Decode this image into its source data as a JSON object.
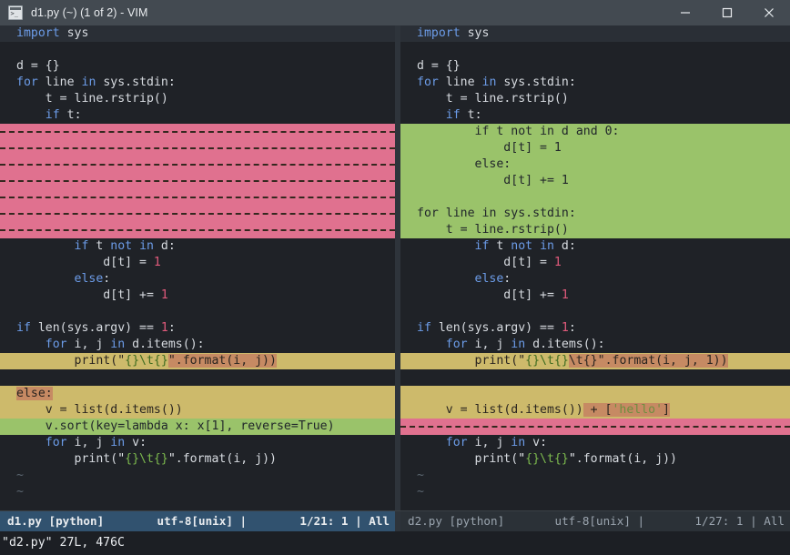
{
  "window": {
    "title": "d1.py (~) (1 of 2) - VIM",
    "icon": "terminal-icon",
    "controls": {
      "minimize": "minimize-icon",
      "maximize": "maximize-icon",
      "close": "close-icon"
    }
  },
  "colors": {
    "titlebar": "#434a51",
    "editor_bg": "#1f2227",
    "cursorline": "#2a2f36",
    "diff_add": "#9ac36a",
    "diff_delete": "#e0718f",
    "diff_change": "#cdba6b",
    "diff_text": "#c68a63",
    "statusline_active": "#31526f",
    "statusline_inactive": "#2b3137",
    "keyword": "#6c9ce8",
    "number": "#e05a7b",
    "string_format": "#7dba4e"
  },
  "panes": {
    "left": {
      "file": "d1.py",
      "lines": [
        {
          "n": 1,
          "kind": "cursorline",
          "text": "import sys"
        },
        {
          "n": 2,
          "kind": "normal",
          "text": ""
        },
        {
          "n": 3,
          "kind": "normal",
          "text": "d = {}"
        },
        {
          "n": 4,
          "kind": "normal",
          "text": "for line in sys.stdin:"
        },
        {
          "n": 5,
          "kind": "normal",
          "text": "    t = line.rstrip()"
        },
        {
          "n": 6,
          "kind": "normal",
          "text": "    if t:"
        },
        {
          "n": 7,
          "kind": "filler",
          "text": ""
        },
        {
          "n": 8,
          "kind": "filler",
          "text": ""
        },
        {
          "n": 9,
          "kind": "filler",
          "text": ""
        },
        {
          "n": 10,
          "kind": "filler",
          "text": ""
        },
        {
          "n": 11,
          "kind": "filler",
          "text": ""
        },
        {
          "n": 12,
          "kind": "filler",
          "text": ""
        },
        {
          "n": 13,
          "kind": "filler",
          "text": ""
        },
        {
          "n": 14,
          "kind": "normal",
          "text": "        if t not in d:"
        },
        {
          "n": 15,
          "kind": "normal",
          "text": "            d[t] = 1"
        },
        {
          "n": 16,
          "kind": "normal",
          "text": "        else:"
        },
        {
          "n": 17,
          "kind": "normal",
          "text": "            d[t] += 1"
        },
        {
          "n": 18,
          "kind": "normal",
          "text": ""
        },
        {
          "n": 19,
          "kind": "normal",
          "text": "if len(sys.argv) == 1:"
        },
        {
          "n": 20,
          "kind": "normal",
          "text": "    for i, j in d.items():"
        },
        {
          "n": 21,
          "kind": "change",
          "text": "        print(\"{}\\t{}\".format(i, j))",
          "plain": "        print(\"{}\\t{}",
          "changed": "\".format(i, j))"
        },
        {
          "n": 22,
          "kind": "normal",
          "text": ""
        },
        {
          "n": 23,
          "kind": "change",
          "text": "else:",
          "plain": "",
          "changed": "else:"
        },
        {
          "n": 24,
          "kind": "change",
          "text": "    v = list(d.items())",
          "plain": "    v = list(d.items())",
          "changed": ""
        },
        {
          "n": 25,
          "kind": "add",
          "text": "    v.sort(key=lambda x: x[1], reverse=True)"
        },
        {
          "n": 26,
          "kind": "normal",
          "text": "    for i, j in v:"
        },
        {
          "n": 27,
          "kind": "normal",
          "text": "        print(\"{}\\t{}\".format(i, j))"
        }
      ],
      "tildes": 2,
      "status": {
        "file": "d1.py [python]",
        "encoding": "utf-8[unix] |",
        "position": "1/21: 1 |",
        "scroll": "All"
      }
    },
    "right": {
      "file": "d2.py",
      "lines": [
        {
          "n": 1,
          "kind": "cursorline",
          "text": "import sys"
        },
        {
          "n": 2,
          "kind": "normal",
          "text": ""
        },
        {
          "n": 3,
          "kind": "normal",
          "text": "d = {}"
        },
        {
          "n": 4,
          "kind": "normal",
          "text": "for line in sys.stdin:"
        },
        {
          "n": 5,
          "kind": "normal",
          "text": "    t = line.rstrip()"
        },
        {
          "n": 6,
          "kind": "normal",
          "text": "    if t:"
        },
        {
          "n": 7,
          "kind": "add",
          "text": "        if t not in d and 0:"
        },
        {
          "n": 8,
          "kind": "add",
          "text": "            d[t] = 1"
        },
        {
          "n": 9,
          "kind": "add",
          "text": "        else:"
        },
        {
          "n": 10,
          "kind": "add",
          "text": "            d[t] += 1"
        },
        {
          "n": 11,
          "kind": "add",
          "text": ""
        },
        {
          "n": 12,
          "kind": "add",
          "text": "for line in sys.stdin:"
        },
        {
          "n": 13,
          "kind": "add",
          "text": "    t = line.rstrip()"
        },
        {
          "n": 14,
          "kind": "normal",
          "text": "        if t not in d:"
        },
        {
          "n": 15,
          "kind": "normal",
          "text": "            d[t] = 1"
        },
        {
          "n": 16,
          "kind": "normal",
          "text": "        else:"
        },
        {
          "n": 17,
          "kind": "normal",
          "text": "            d[t] += 1"
        },
        {
          "n": 18,
          "kind": "normal",
          "text": ""
        },
        {
          "n": 19,
          "kind": "normal",
          "text": "if len(sys.argv) == 1:"
        },
        {
          "n": 20,
          "kind": "normal",
          "text": "    for i, j in d.items():"
        },
        {
          "n": 21,
          "kind": "change",
          "text": "        print(\"{}\\t{}\\t{}\".format(i, j, 1))",
          "plain": "        print(\"{}\\t{}",
          "changed": "\\t{}\".format(i, j, 1))"
        },
        {
          "n": 22,
          "kind": "normal",
          "text": ""
        },
        {
          "n": 23,
          "kind": "change",
          "text": "",
          "plain": "",
          "changed": ""
        },
        {
          "n": 24,
          "kind": "change",
          "text": "    v = list(d.items()) + ['hello']",
          "plain": "    v = list(d.items())",
          "changed": " + ['hello']"
        },
        {
          "n": 25,
          "kind": "filler",
          "text": ""
        },
        {
          "n": 26,
          "kind": "normal",
          "text": "    for i, j in v:"
        },
        {
          "n": 27,
          "kind": "normal",
          "text": "        print(\"{}\\t{}\".format(i, j))"
        }
      ],
      "tildes": 2,
      "status": {
        "file": "d2.py [python]",
        "encoding": "utf-8[unix] |",
        "position": "1/27: 1 |",
        "scroll": "All"
      }
    }
  },
  "command_line": "\"d2.py\" 27L, 476C"
}
